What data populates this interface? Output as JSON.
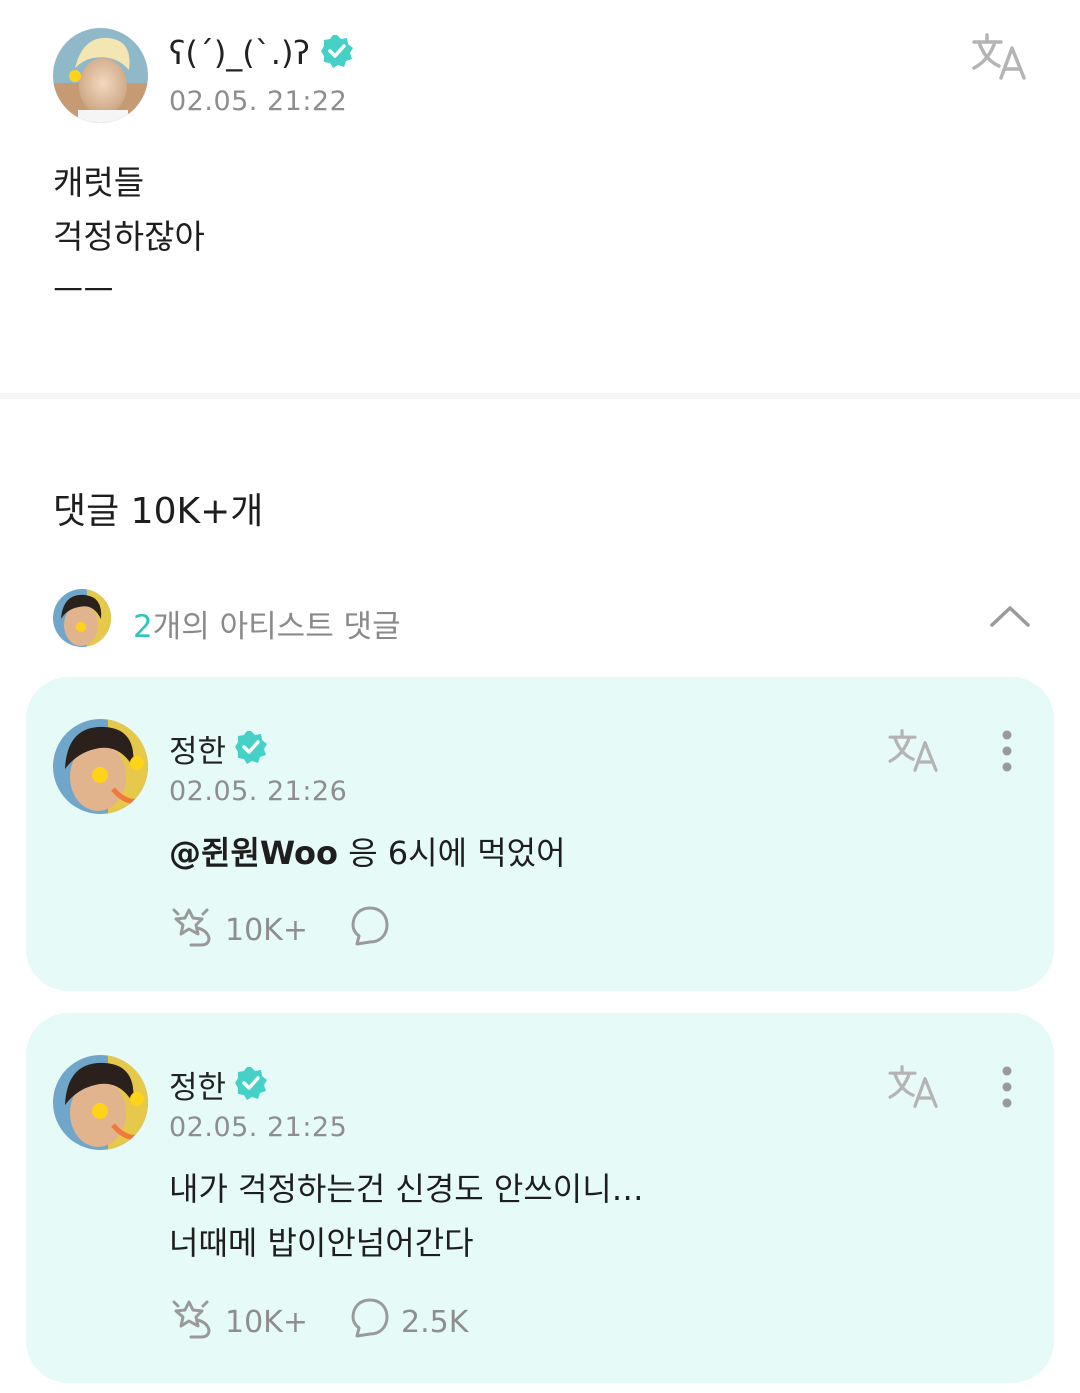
{
  "post": {
    "author_name": "ʕ(ˊ)_(ˋ.)ʔ",
    "timestamp": "02.05. 21:22",
    "body_lines": [
      "캐럿들",
      "걱정하잖아",
      "ㅡㅡ"
    ]
  },
  "comments_section": {
    "title": "댓글 10K+개",
    "artist_comments_count": "2",
    "artist_comments_label": "개의 아티스트 댓글"
  },
  "comments": [
    {
      "author": "정한",
      "timestamp": "02.05. 21:26",
      "mention": "@쥔원Woo",
      "text": " 응 6시에 먹었어",
      "likes": "10K+",
      "replies": ""
    },
    {
      "author": "정한",
      "timestamp": "02.05. 21:25",
      "text_line1": "내가 걱정하는건 신경도 안쓰이니…",
      "text_line2": "너때메 밥이안넘어간다",
      "likes": "10K+",
      "replies": "2.5K"
    }
  ],
  "colors": {
    "accent": "#2ec4c0",
    "card_background": "#e6fbf7",
    "verified_badge": "#45d1c6"
  },
  "icons": [
    "verified-badge-icon",
    "translate-icon",
    "more-vertical-icon",
    "like-icon",
    "reply-icon",
    "chevron-up-icon"
  ]
}
